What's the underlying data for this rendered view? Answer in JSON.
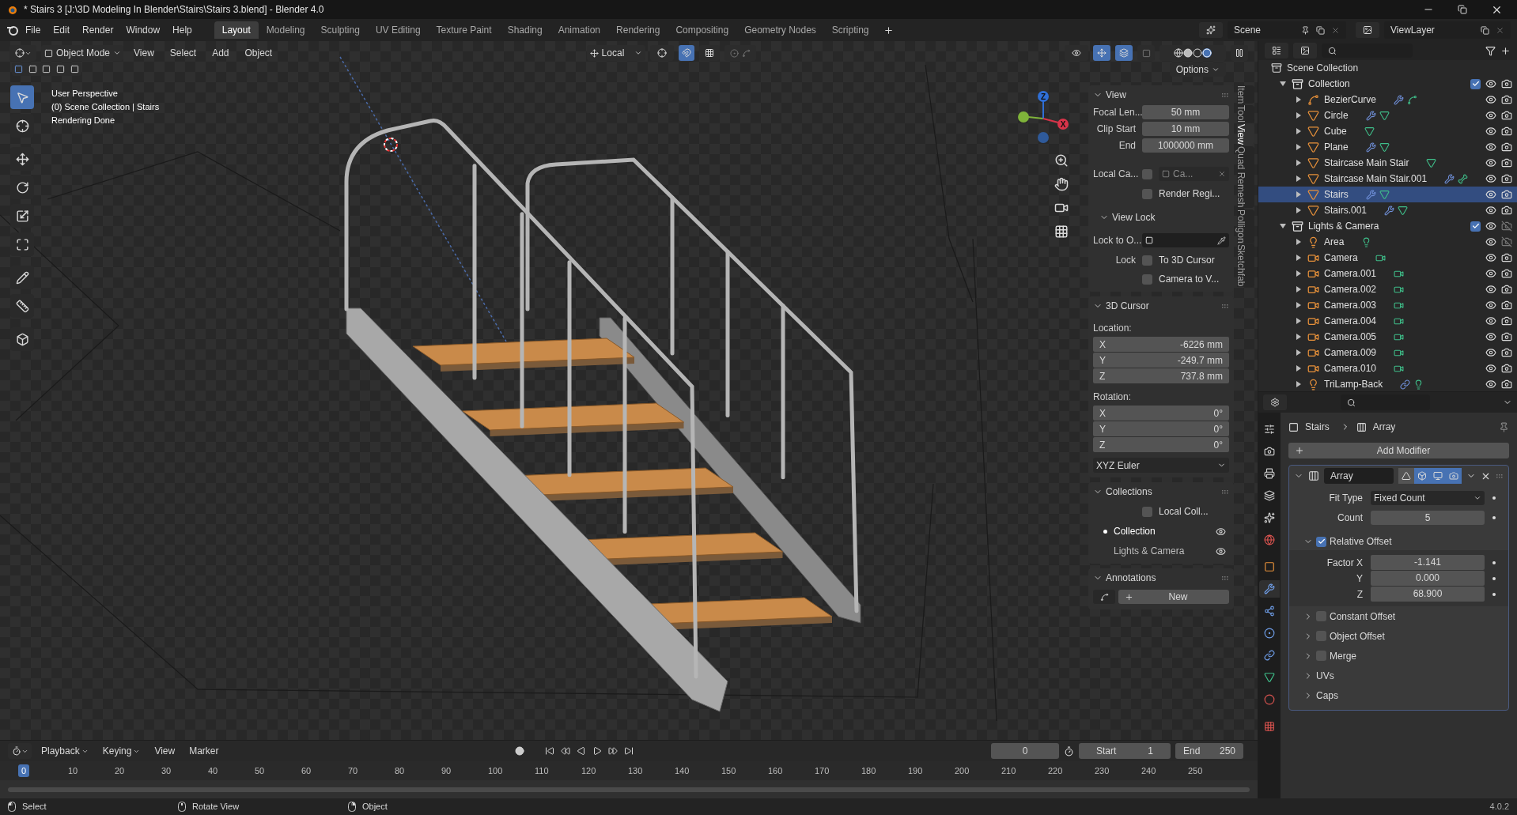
{
  "title_bar": {
    "title": "* Stairs 3 [J:\\3D Modeling In Blender\\Stairs\\Stairs 3.blend] - Blender 4.0"
  },
  "menus": [
    "File",
    "Edit",
    "Render",
    "Window",
    "Help"
  ],
  "workspaces": [
    {
      "label": "Layout",
      "selected": true
    },
    {
      "label": "Modeling",
      "selected": false
    },
    {
      "label": "Sculpting",
      "selected": false
    },
    {
      "label": "UV Editing",
      "selected": false
    },
    {
      "label": "Texture Paint",
      "selected": false
    },
    {
      "label": "Shading",
      "selected": false
    },
    {
      "label": "Animation",
      "selected": false
    },
    {
      "label": "Rendering",
      "selected": false
    },
    {
      "label": "Compositing",
      "selected": false
    },
    {
      "label": "Geometry Nodes",
      "selected": false
    },
    {
      "label": "Scripting",
      "selected": false
    }
  ],
  "scene": "Scene",
  "view_layer": "ViewLayer",
  "viewport": {
    "mode": "Object Mode",
    "menus": [
      "View",
      "Select",
      "Add",
      "Object"
    ],
    "orientation": "Local",
    "options": "Options",
    "info": [
      "User Perspective",
      "(0) Scene Collection | Stairs",
      "Rendering Done"
    ],
    "tools": [
      {
        "kind": "select",
        "selected": true
      },
      {
        "kind": "cursor",
        "selected": false
      },
      {
        "kind": "move",
        "selected": false
      },
      {
        "kind": "rotate",
        "selected": false
      },
      {
        "kind": "scale",
        "selected": false
      },
      {
        "kind": "transform",
        "selected": false
      },
      {
        "kind": "annotate",
        "selected": false
      },
      {
        "kind": "measure",
        "selected": false
      },
      {
        "kind": "add_cube",
        "selected": false
      }
    ],
    "gizmo": [
      {
        "label": "Z",
        "color": "#2f6fd6"
      },
      {
        "label": "X",
        "color": "#d8344a"
      }
    ]
  },
  "sidebar": {
    "tabs": [
      {
        "label": "Item",
        "selected": false
      },
      {
        "label": "Tool",
        "selected": false
      },
      {
        "label": "View",
        "selected": true
      },
      {
        "label": "Quad Remesh",
        "selected": false
      },
      {
        "label": "Polligon",
        "selected": false
      },
      {
        "label": "Sketchfab",
        "selected": false
      }
    ],
    "panels": [
      {
        "title": "View",
        "expanded": true,
        "rows": [
          {
            "kind": "field",
            "label": "Focal Len...",
            "value": "50 mm"
          },
          {
            "kind": "field",
            "label": "Clip Start",
            "value": "10 mm"
          },
          {
            "kind": "field",
            "label": "End",
            "value": "1000000 mm"
          },
          {
            "kind": "object",
            "label": "Local Ca...",
            "checked": false,
            "placeholder": "Ca..."
          },
          {
            "kind": "check",
            "text": "Render Regi...",
            "checked": false
          },
          {
            "kind": "subheader",
            "text": "View Lock",
            "expanded": true
          },
          {
            "kind": "picker",
            "label": "Lock to O..."
          },
          {
            "kind": "check",
            "label": "Lock",
            "text": "To 3D Cursor",
            "checked": false
          },
          {
            "kind": "check",
            "text": "Camera to V...",
            "checked": false
          }
        ]
      },
      {
        "title": "3D Cursor",
        "expanded": true,
        "rows": [
          {
            "kind": "heading",
            "text": "Location:"
          },
          {
            "kind": "vector",
            "items": [
              {
                "axis": "X",
                "value": "-6226 mm"
              },
              {
                "axis": "Y",
                "value": "-249.7 mm"
              },
              {
                "axis": "Z",
                "value": "737.8 mm"
              }
            ]
          },
          {
            "kind": "heading",
            "text": "Rotation:"
          },
          {
            "kind": "vector",
            "items": [
              {
                "axis": "X",
                "value": "0°"
              },
              {
                "axis": "Y",
                "value": "0°"
              },
              {
                "axis": "Z",
                "value": "0°"
              }
            ]
          },
          {
            "kind": "dropdown",
            "value": "XYZ Euler"
          }
        ]
      },
      {
        "title": "Collections",
        "expanded": true,
        "rows": [
          {
            "kind": "check",
            "text": "Local Coll...",
            "checked": false
          },
          {
            "kind": "collection",
            "text": "Collection",
            "active": true
          },
          {
            "kind": "collection",
            "text": "Lights & Camera",
            "active": false
          }
        ]
      },
      {
        "title": "Annotations",
        "expanded": true,
        "rows": [
          {
            "kind": "new",
            "text": "New"
          }
        ]
      }
    ]
  },
  "outliner": {
    "root": "Scene Collection",
    "tree": [
      {
        "name": "Collection",
        "kind": "collection",
        "selected": false,
        "expanded": true,
        "checked": true,
        "renderable": true,
        "children": [
          {
            "name": "BezierCurve",
            "kind": "curve",
            "selected": false,
            "expanded": false,
            "renderable": true,
            "badges": [
              {
                "kind": "modifier"
              },
              {
                "kind": "curve"
              }
            ]
          },
          {
            "name": "Circle",
            "kind": "mesh",
            "selected": false,
            "expanded": false,
            "renderable": true,
            "badges": [
              {
                "kind": "modifier"
              },
              {
                "kind": "mesh"
              }
            ]
          },
          {
            "name": "Cube",
            "kind": "mesh",
            "selected": false,
            "expanded": false,
            "renderable": true,
            "badges": [
              {
                "kind": "mesh"
              }
            ]
          },
          {
            "name": "Plane",
            "kind": "mesh",
            "selected": false,
            "expanded": false,
            "renderable": true,
            "badges": [
              {
                "kind": "modifier"
              },
              {
                "kind": "mesh"
              }
            ]
          },
          {
            "name": "Staircase Main Stair",
            "kind": "mesh",
            "selected": false,
            "expanded": false,
            "renderable": true,
            "badges": [
              {
                "kind": "mesh"
              }
            ]
          },
          {
            "name": "Staircase Main Stair.001",
            "kind": "mesh",
            "selected": false,
            "expanded": false,
            "renderable": true,
            "badges": [
              {
                "kind": "modifier"
              },
              {
                "kind": "bone"
              }
            ]
          },
          {
            "name": "Stairs",
            "kind": "mesh",
            "selected": true,
            "expanded": false,
            "renderable": true,
            "badges": [
              {
                "kind": "modifier"
              },
              {
                "kind": "mesh"
              }
            ]
          },
          {
            "name": "Stairs.001",
            "kind": "mesh",
            "selected": false,
            "expanded": false,
            "renderable": true,
            "badges": [
              {
                "kind": "modifier"
              },
              {
                "kind": "mesh"
              }
            ]
          }
        ]
      },
      {
        "name": "Lights & Camera",
        "kind": "collection",
        "selected": false,
        "expanded": true,
        "checked": true,
        "renderable": false,
        "children": [
          {
            "name": "Area",
            "kind": "light",
            "selected": false,
            "expanded": false,
            "renderable": false,
            "badges": [
              {
                "kind": "light"
              }
            ]
          },
          {
            "name": "Camera",
            "kind": "camera",
            "selected": false,
            "expanded": false,
            "renderable": true,
            "badges": [
              {
                "kind": "camera"
              }
            ]
          },
          {
            "name": "Camera.001",
            "kind": "camera",
            "selected": false,
            "expanded": false,
            "renderable": true,
            "badges": [
              {
                "kind": "camera"
              }
            ]
          },
          {
            "name": "Camera.002",
            "kind": "camera",
            "selected": false,
            "expanded": false,
            "renderable": true,
            "badges": [
              {
                "kind": "camera"
              }
            ]
          },
          {
            "name": "Camera.003",
            "kind": "camera",
            "selected": false,
            "expanded": false,
            "renderable": true,
            "badges": [
              {
                "kind": "camera"
              }
            ]
          },
          {
            "name": "Camera.004",
            "kind": "camera",
            "selected": false,
            "expanded": false,
            "renderable": true,
            "badges": [
              {
                "kind": "camera"
              }
            ]
          },
          {
            "name": "Camera.005",
            "kind": "camera",
            "selected": false,
            "expanded": false,
            "renderable": true,
            "badges": [
              {
                "kind": "camera"
              }
            ]
          },
          {
            "name": "Camera.009",
            "kind": "camera",
            "selected": false,
            "expanded": false,
            "renderable": true,
            "badges": [
              {
                "kind": "camera"
              }
            ]
          },
          {
            "name": "Camera.010",
            "kind": "camera",
            "selected": false,
            "expanded": false,
            "renderable": true,
            "badges": [
              {
                "kind": "camera"
              }
            ]
          },
          {
            "name": "TriLamp-Back",
            "kind": "light",
            "selected": false,
            "expanded": false,
            "renderable": true,
            "badges": [
              {
                "kind": "constraint"
              },
              {
                "kind": "light"
              }
            ]
          }
        ]
      }
    ]
  },
  "properties": {
    "tabs": [
      {
        "kind": "tool",
        "selected": false
      },
      {
        "kind": "render",
        "selected": false
      },
      {
        "kind": "output",
        "selected": false
      },
      {
        "kind": "view_layer",
        "selected": false
      },
      {
        "kind": "scene",
        "selected": false
      },
      {
        "kind": "world",
        "selected": false
      },
      {
        "kind": "object",
        "selected": false
      },
      {
        "kind": "modifiers",
        "selected": true
      },
      {
        "kind": "particles",
        "selected": false
      },
      {
        "kind": "physics",
        "selected": false
      },
      {
        "kind": "constraints",
        "selected": false
      },
      {
        "kind": "data",
        "selected": false
      },
      {
        "kind": "material",
        "selected": false
      },
      {
        "kind": "texture",
        "selected": false
      }
    ],
    "breadcrumb": [
      "Stairs",
      "Array"
    ],
    "add_modifier": "Add Modifier",
    "modifier": {
      "name": "Array",
      "expanded": true,
      "toggles": [
        {
          "kind": "edit_cage",
          "on": false
        },
        {
          "kind": "edit_mode",
          "on": true
        },
        {
          "kind": "viewport",
          "on": true
        },
        {
          "kind": "render",
          "on": true
        }
      ],
      "fit_type": {
        "label": "Fit Type",
        "value": "Fixed Count"
      },
      "count": {
        "label": "Count",
        "value": "5"
      },
      "relative_offset": {
        "label": "Relative Offset",
        "checked": true,
        "expanded": true,
        "factors": [
          {
            "label": "Factor X",
            "value": "-1.141"
          },
          {
            "label": "Y",
            "value": "0.000"
          },
          {
            "label": "Z",
            "value": "68.900"
          }
        ]
      },
      "subpanels": [
        {
          "kind": "check",
          "label": "Constant Offset",
          "checked": false,
          "expanded": false
        },
        {
          "kind": "check",
          "label": "Object Offset",
          "checked": false,
          "expanded": false
        },
        {
          "kind": "check",
          "label": "Merge",
          "checked": false,
          "expanded": false
        },
        {
          "kind": "plain",
          "label": "UVs",
          "expanded": false
        },
        {
          "kind": "plain",
          "label": "Caps",
          "expanded": false
        }
      ]
    }
  },
  "timeline": {
    "menus": [
      "Playback",
      "Keying",
      "View",
      "Marker"
    ],
    "current_frame": "0",
    "start": {
      "label": "Start",
      "value": "1"
    },
    "end": {
      "label": "End",
      "value": "250"
    },
    "ticks": [
      {
        "label": "0",
        "selected": true
      },
      {
        "label": "10",
        "selected": false
      },
      {
        "label": "20",
        "selected": false
      },
      {
        "label": "30",
        "selected": false
      },
      {
        "label": "40",
        "selected": false
      },
      {
        "label": "50",
        "selected": false
      },
      {
        "label": "60",
        "selected": false
      },
      {
        "label": "70",
        "selected": false
      },
      {
        "label": "80",
        "selected": false
      },
      {
        "label": "90",
        "selected": false
      },
      {
        "label": "100",
        "selected": false
      },
      {
        "label": "110",
        "selected": false
      },
      {
        "label": "120",
        "selected": false
      },
      {
        "label": "130",
        "selected": false
      },
      {
        "label": "140",
        "selected": false
      },
      {
        "label": "150",
        "selected": false
      },
      {
        "label": "160",
        "selected": false
      },
      {
        "label": "170",
        "selected": false
      },
      {
        "label": "180",
        "selected": false
      },
      {
        "label": "190",
        "selected": false
      },
      {
        "label": "200",
        "selected": false
      },
      {
        "label": "210",
        "selected": false
      },
      {
        "label": "220",
        "selected": false
      },
      {
        "label": "230",
        "selected": false
      },
      {
        "label": "240",
        "selected": false
      },
      {
        "label": "250",
        "selected": false
      }
    ]
  },
  "status_bar": {
    "items": [
      {
        "kind": "mouse_left",
        "text": "Select"
      },
      {
        "kind": "mouse_middle",
        "text": "Rotate View"
      },
      {
        "kind": "mouse_right",
        "text": "Object"
      }
    ],
    "version": "4.0.2"
  }
}
